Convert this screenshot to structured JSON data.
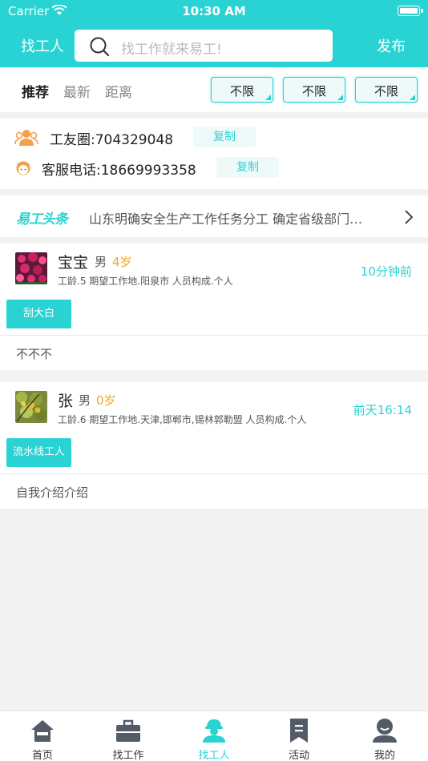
{
  "status_bar": {
    "carrier": "Carrier",
    "time": "10:30 AM"
  },
  "nav": {
    "title": "找工人",
    "search_placeholder": "找工作就来易工!",
    "publish_label": "发布"
  },
  "filters": {
    "sort_tabs": [
      "推荐",
      "最新",
      "距离"
    ],
    "dropdowns": [
      "不限",
      "不限",
      "不限"
    ]
  },
  "contact": {
    "group_text": "工友圈:704329048",
    "phone_text": "客服电话:18669993358",
    "copy_label": "复制"
  },
  "headline": {
    "logo": "易工头条",
    "text": "山东明确安全生产工作任务分工 确定省级部门…"
  },
  "workers": [
    {
      "name": "宝宝",
      "gender": "男",
      "age": "4岁",
      "info": "工龄.5 期望工作地.阳泉市 人员构成.个人",
      "time": "10分钟前",
      "tag": "刮大白",
      "intro": "不不不"
    },
    {
      "name": "张",
      "gender": "男",
      "age": "0岁",
      "info": "工龄.6 期望工作地.天津,邯郸市,锡林郭勒盟 人员构成.个人",
      "time": "前天16:14",
      "tag": "流水线工人",
      "intro": "自我介绍介绍"
    }
  ],
  "tab_bar": {
    "items": [
      "首页",
      "找工作",
      "找工人",
      "活动",
      "我的"
    ],
    "active_index": 2
  },
  "colors": {
    "accent": "#2ad3d3",
    "age_orange": "#f5a623",
    "icon_orange": "#f5a04a",
    "tab_icon_gray": "#555b66"
  }
}
